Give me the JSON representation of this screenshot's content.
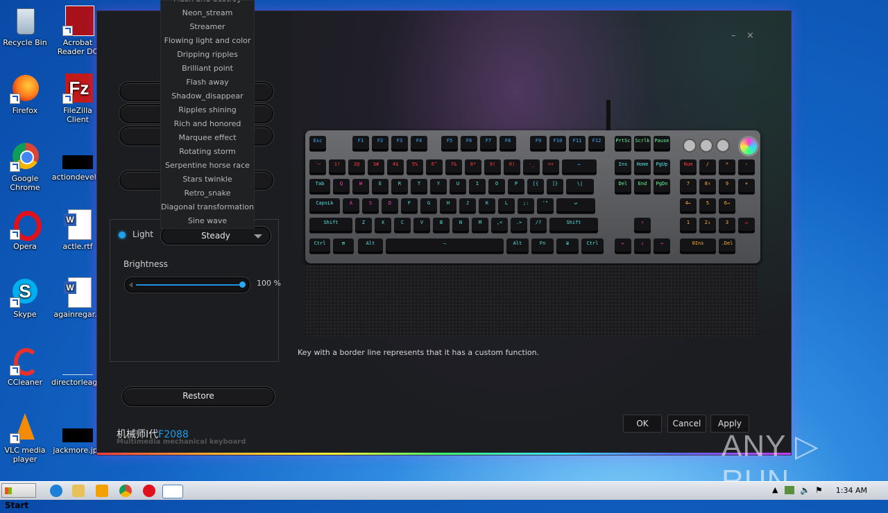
{
  "desktop": {
    "icons": [
      {
        "label": "Recycle Bin"
      },
      {
        "label": "Acrobat Reader DC"
      },
      {
        "label": "Firefox"
      },
      {
        "label": "FileZilla Client"
      },
      {
        "label": "Google Chrome"
      },
      {
        "label": "actiondevel..."
      },
      {
        "label": "Opera"
      },
      {
        "label": "actle.rtf"
      },
      {
        "label": "Skype"
      },
      {
        "label": "againregar..."
      },
      {
        "label": "CCleaner"
      },
      {
        "label": "directorleag..."
      },
      {
        "label": "VLC media player"
      },
      {
        "label": "jackmore.jpg"
      }
    ]
  },
  "app": {
    "window_controls": {
      "minimize": "–",
      "close": "×"
    },
    "light_label": "Light",
    "mode_selected": "Steady",
    "dropdown_options": [
      "Flash and destroy",
      "Neon_stream",
      "Streamer",
      "Flowing light and color",
      "Dripping ripples",
      "Brilliant point",
      "Flash away",
      "Shadow_disappear",
      "Ripples shining",
      "Rich and honored",
      "Marquee effect",
      "Rotating storm",
      "Serpentine horse race",
      "Stars twinkle",
      "Retro_snake",
      "Diagonal transformation",
      "Sine wave"
    ],
    "brightness_label": "Brightness",
    "brightness_value": "100 %",
    "brightness_level": 1.0,
    "restore_label": "Restore",
    "footer_note": "Key with a border line represents that it has a custom function.",
    "brand_cn": "机械师I代",
    "brand_model": "F2088",
    "brand_sub": "Multimedia mechanical keyboard",
    "ok_label": "OK",
    "cancel_label": "Cancel",
    "apply_label": "Apply",
    "accent_color": "#1e9fe8"
  },
  "keyboard": {
    "row1": [
      "Esc",
      "F1",
      "F2",
      "F3",
      "F4",
      "F5",
      "F6",
      "F7",
      "F8",
      "F9",
      "F10",
      "F11",
      "F12",
      "PrtSc",
      "Scrlk",
      "Pause"
    ],
    "row2": [
      "`~",
      "1!",
      "2@",
      "3#",
      "4$",
      "5%",
      "6^",
      "7&",
      "8*",
      "9(",
      "0)",
      "-_",
      "=+",
      "←",
      "Ins",
      "Home",
      "PgUp",
      "Num",
      "/",
      "*",
      "-"
    ],
    "row3": [
      "Tab",
      "Q",
      "W",
      "E",
      "R",
      "T",
      "Y",
      "U",
      "I",
      "O",
      "P",
      "[{",
      "]}",
      "\\|",
      "Del",
      "End",
      "PgDn",
      "7",
      "8↑",
      "9",
      "+"
    ],
    "row4": [
      "CapsLk",
      "A",
      "S",
      "D",
      "F",
      "G",
      "H",
      "J",
      "K",
      "L",
      ";:",
      "'\"",
      "↵",
      "4←",
      "5",
      "6→"
    ],
    "row5": [
      "Shift",
      "Z",
      "X",
      "C",
      "V",
      "B",
      "N",
      "M",
      ",<",
      ".>",
      "/?",
      "Shift",
      "↑",
      "1",
      "2↓",
      "3",
      "↵"
    ],
    "row6": [
      "Ctrl",
      "⊞",
      "Alt",
      "—",
      "Alt",
      "Fn",
      "≣",
      "Ctrl",
      "←",
      "↓",
      "→",
      "0Ins",
      ".Del"
    ]
  },
  "taskbar": {
    "start_label": "Start",
    "clock": "1:34 AM"
  },
  "watermark": "ANY ▷ RUN"
}
